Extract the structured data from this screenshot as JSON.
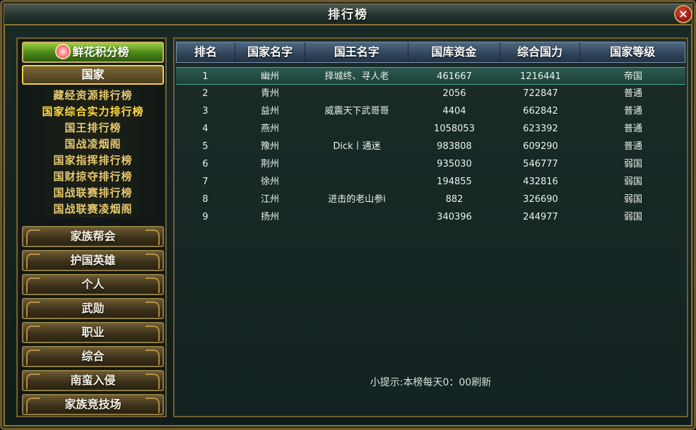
{
  "window": {
    "title": "排行榜",
    "close_icon": "×"
  },
  "sidebar": {
    "top_tab": "鲜花积分榜",
    "selected_category": "国家",
    "sub_items": [
      "藏经资源排行榜",
      "国家综合实力排行榜",
      "国王排行榜",
      "国战凌烟阁",
      "国家指挥排行榜",
      "国财掠夺排行榜",
      "国战联赛排行榜",
      "国战联赛凌烟阁"
    ],
    "active_sub_index": 1,
    "categories": [
      "家族帮会",
      "护国英雄",
      "个人",
      "武勋",
      "职业",
      "综合",
      "南蛮入侵",
      "家族竞技场"
    ]
  },
  "table": {
    "headers": [
      "排名",
      "国家名字",
      "国王名字",
      "国库资金",
      "综合国力",
      "国家等级"
    ],
    "rows": [
      [
        "1",
        "幽州",
        "择城终、寻人老",
        "461667",
        "1216441",
        "帝国"
      ],
      [
        "2",
        "青州",
        "",
        "2056",
        "722847",
        "普通"
      ],
      [
        "3",
        "益州",
        "威震天下武哥哥",
        "4404",
        "662842",
        "普通"
      ],
      [
        "4",
        "燕州",
        "",
        "1058053",
        "623392",
        "普通"
      ],
      [
        "5",
        "豫州",
        "Dick丨通迷",
        "983808",
        "609290",
        "普通"
      ],
      [
        "6",
        "荆州",
        "",
        "935030",
        "546777",
        "弱国"
      ],
      [
        "7",
        "徐州",
        "",
        "194855",
        "432816",
        "弱国"
      ],
      [
        "8",
        "江州",
        "进击的老山参i",
        "882",
        "326690",
        "弱国"
      ],
      [
        "9",
        "扬州",
        "",
        "340396",
        "244977",
        "弱国"
      ]
    ],
    "highlight_row": 0
  },
  "hint": "小提示:本榜每天0：00刷新",
  "colors": {
    "accent_gold": "#f0d24a",
    "sub_item_text": "#e4c770",
    "active_sub_item": "#ffd93a",
    "header_blue": "#304459",
    "highlight_row": "#2c5a50"
  }
}
